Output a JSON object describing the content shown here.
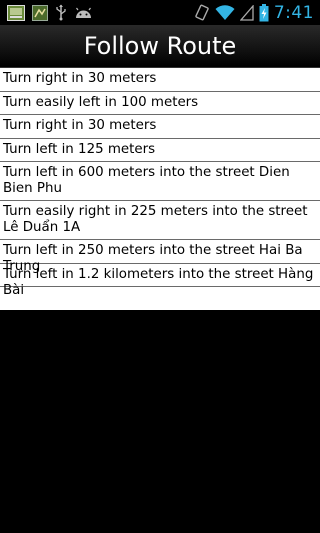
{
  "status_bar": {
    "time": "7:41",
    "icons": [
      "image-notification-icon",
      "map-notification-icon",
      "usb-icon",
      "android-debug-icon",
      "vibrate-icon",
      "wifi-icon",
      "signal-icon",
      "battery-charging-icon"
    ]
  },
  "header": {
    "title": "Follow Route"
  },
  "directions": [
    "Turn right in 30 meters",
    "Turn easily left in 100 meters",
    "Turn right in 30 meters",
    "Turn left in 125 meters",
    "Turn left in 600 meters into the street Dien Bien Phu",
    "Turn easily right in 225 meters into the street Lê Duẩn 1A",
    "Turn left in 250 meters into the street Hai Ba Trung",
    "Turn left in 1.2 kilometers into the street Hàng Bài"
  ],
  "colors": {
    "clock": "#33b5e5",
    "list_background": "#ffffff",
    "screen_background": "#000000"
  }
}
